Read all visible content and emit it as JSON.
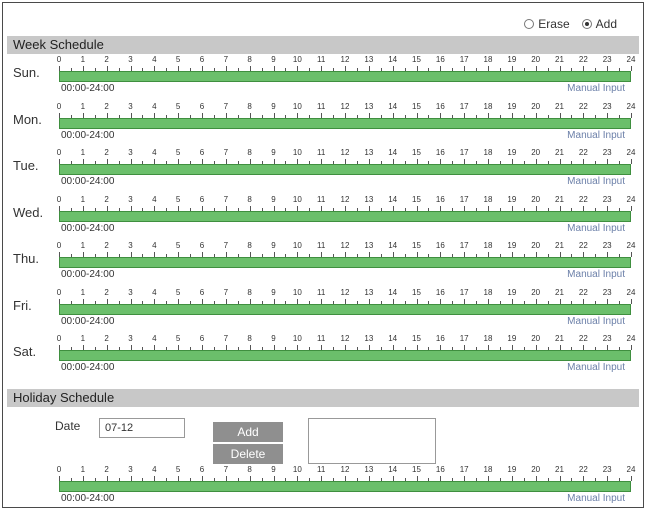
{
  "mode": {
    "erase_label": "Erase",
    "add_label": "Add",
    "selected": "Add"
  },
  "week_schedule": {
    "title": "Week Schedule",
    "hours": [
      "0",
      "1",
      "2",
      "3",
      "4",
      "5",
      "6",
      "7",
      "8",
      "9",
      "10",
      "11",
      "12",
      "13",
      "14",
      "15",
      "16",
      "17",
      "18",
      "19",
      "20",
      "21",
      "22",
      "23",
      "24"
    ],
    "days": [
      {
        "label": "Sun.",
        "range": "00:00-24:00",
        "manual": "Manual Input"
      },
      {
        "label": "Mon.",
        "range": "00:00-24:00",
        "manual": "Manual Input"
      },
      {
        "label": "Tue.",
        "range": "00:00-24:00",
        "manual": "Manual Input"
      },
      {
        "label": "Wed.",
        "range": "00:00-24:00",
        "manual": "Manual Input"
      },
      {
        "label": "Thu.",
        "range": "00:00-24:00",
        "manual": "Manual Input"
      },
      {
        "label": "Fri.",
        "range": "00:00-24:00",
        "manual": "Manual Input"
      },
      {
        "label": "Sat.",
        "range": "00:00-24:00",
        "manual": "Manual Input"
      }
    ]
  },
  "holiday_schedule": {
    "title": "Holiday Schedule",
    "date_label": "Date",
    "date_value": "07-12",
    "add_button": "Add",
    "delete_button": "Delete",
    "range": "00:00-24:00",
    "manual": "Manual Input"
  },
  "colors": {
    "bar_fill": "#6bbf6b",
    "header_bg": "#c8c8c8",
    "button_bg": "#8f8f8f",
    "manual_link": "#6b7fa8"
  }
}
